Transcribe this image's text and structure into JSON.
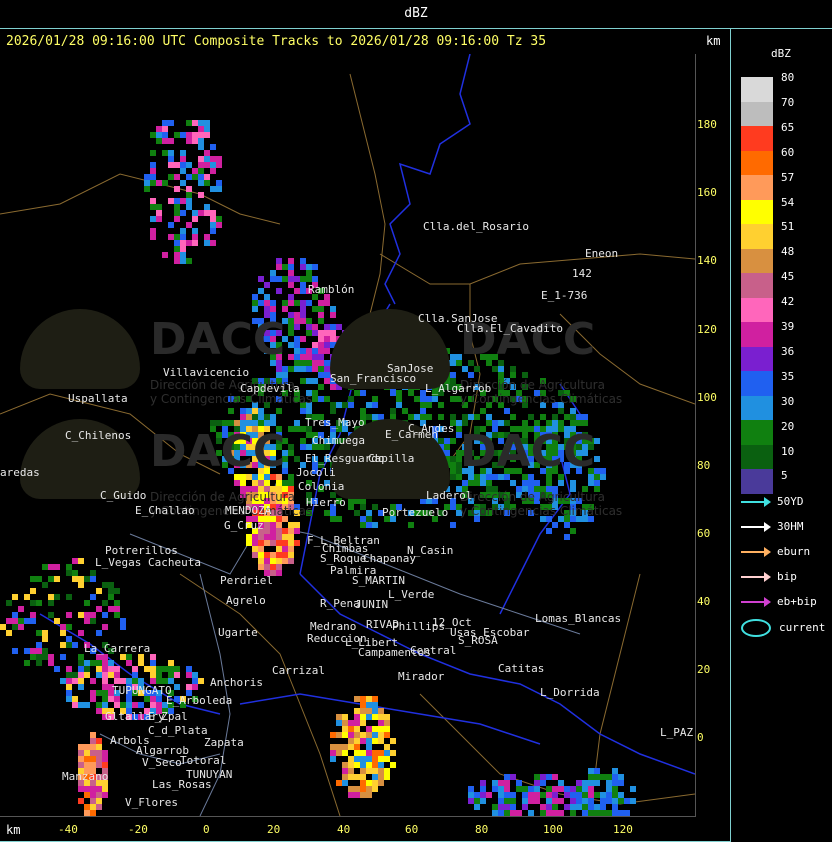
{
  "title": "dBZ",
  "track_line": "2026/01/28 09:16:00 UTC Composite Tracks to 2026/01/28 09:16:00 Tz 35",
  "km_top": "km",
  "km_bottom": "km",
  "watermark": {
    "text": "DACC",
    "sub1": "Dirección de Agricultura",
    "sub2": "y Contingencias Climáticas"
  },
  "y_ticks": [
    "180",
    "160",
    "140",
    "120",
    "100",
    "80",
    "60",
    "40",
    "20",
    "0"
  ],
  "x_ticks": [
    "-40",
    "-20",
    "0",
    "20",
    "40",
    "60",
    "80",
    "100",
    "120"
  ],
  "legend": {
    "title": "dBZ",
    "scale": [
      {
        "value": "80",
        "color": "#d9d9d9"
      },
      {
        "value": "70",
        "color": "#bdbdbd"
      },
      {
        "value": "65",
        "color": "#ff3b1f"
      },
      {
        "value": "60",
        "color": "#ff6a00"
      },
      {
        "value": "57",
        "color": "#ff9a5a"
      },
      {
        "value": "54",
        "color": "#ffff00"
      },
      {
        "value": "51",
        "color": "#ffd030"
      },
      {
        "value": "48",
        "color": "#d89040"
      },
      {
        "value": "45",
        "color": "#c8608a"
      },
      {
        "value": "42",
        "color": "#ff66bb"
      },
      {
        "value": "39",
        "color": "#d020a0"
      },
      {
        "value": "36",
        "color": "#7a1fd0"
      },
      {
        "value": "35",
        "color": "#2060f0"
      },
      {
        "value": "30",
        "color": "#2090e0"
      },
      {
        "value": "20",
        "color": "#108010"
      },
      {
        "value": "10",
        "color": "#0a6010"
      },
      {
        "value": "5",
        "color": "#4a3a9a"
      }
    ],
    "tracks": [
      {
        "label": "50YD",
        "color": "#40e0e0"
      },
      {
        "label": "30HM",
        "color": "#ffffff"
      },
      {
        "label": "eburn",
        "color": "#ffb060"
      },
      {
        "label": "bip",
        "color": "#ffd0d0"
      },
      {
        "label": "eb+bip",
        "color": "#d040d0"
      }
    ],
    "current_label": "current"
  },
  "places": [
    {
      "name": "Clla.del_Rosario"
    },
    {
      "name": "Eneon"
    },
    {
      "name": "142"
    },
    {
      "name": "E_1-736"
    },
    {
      "name": "Ramblón"
    },
    {
      "name": "Clla.SanJose"
    },
    {
      "name": "Clla.El_Cavadito"
    },
    {
      "name": "Villavicencio"
    },
    {
      "name": "Capdevila"
    },
    {
      "name": "San_Francisco"
    },
    {
      "name": "SanJose"
    },
    {
      "name": "L_Algarrob"
    },
    {
      "name": "Uspallata"
    },
    {
      "name": "C_Chilenos"
    },
    {
      "name": "Tres_Mayo"
    },
    {
      "name": "Chimuega"
    },
    {
      "name": "E_Carmen"
    },
    {
      "name": "C_Andes"
    },
    {
      "name": "aredas"
    },
    {
      "name": "El_Resguardo"
    },
    {
      "name": "Jocoli"
    },
    {
      "name": "Capilla"
    },
    {
      "name": "Colonia"
    },
    {
      "name": "Laderol"
    },
    {
      "name": "C_Guido"
    },
    {
      "name": "E_Challao"
    },
    {
      "name": "Hierro"
    },
    {
      "name": "Portezuelo"
    },
    {
      "name": "MENDOZA"
    },
    {
      "name": "G_Cruz"
    },
    {
      "name": "F_L_Beltran"
    },
    {
      "name": "Chapanay"
    },
    {
      "name": "Chimbas"
    },
    {
      "name": "N_Casin"
    },
    {
      "name": "Potrerillos"
    },
    {
      "name": "L_Vegas"
    },
    {
      "name": "Cacheuta"
    },
    {
      "name": "S_Roque"
    },
    {
      "name": "Palmira"
    },
    {
      "name": "S_MARTIN"
    },
    {
      "name": "Perdriel"
    },
    {
      "name": "L_Verde"
    },
    {
      "name": "Ugarte"
    },
    {
      "name": "Agrelo"
    },
    {
      "name": "R_Pena"
    },
    {
      "name": "JUNIN"
    },
    {
      "name": "Medrano"
    },
    {
      "name": "Reduccion"
    },
    {
      "name": "RIVAD"
    },
    {
      "name": "Phillips"
    },
    {
      "name": "12_Oct"
    },
    {
      "name": "Lomas_Blancas"
    },
    {
      "name": "Usas_Escobar"
    },
    {
      "name": "S_ROSA"
    },
    {
      "name": "La_Carrera"
    },
    {
      "name": "L_Libert"
    },
    {
      "name": "Campamentos"
    },
    {
      "name": "Central"
    },
    {
      "name": "Carrizal"
    },
    {
      "name": "Catitas"
    },
    {
      "name": "Anchoris"
    },
    {
      "name": "TUPUNGATO"
    },
    {
      "name": "Mirador"
    },
    {
      "name": "L_Dorrida"
    },
    {
      "name": "E_Arboleda"
    },
    {
      "name": "Gltallary"
    },
    {
      "name": "E_Zpal"
    },
    {
      "name": "C_d_Plata"
    },
    {
      "name": "Arbols"
    },
    {
      "name": "Zapata"
    },
    {
      "name": "Algarrob"
    },
    {
      "name": "V_Seco"
    },
    {
      "name": "Totoral"
    },
    {
      "name": "TUNUYAN"
    },
    {
      "name": "Manzano"
    },
    {
      "name": "Las_Rosas"
    },
    {
      "name": "V_Flores"
    },
    {
      "name": "L_PAZ"
    }
  ]
}
